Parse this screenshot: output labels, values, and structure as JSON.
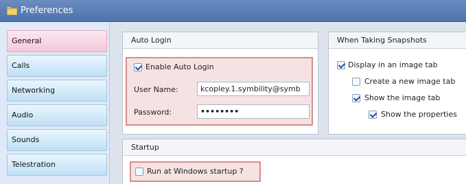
{
  "window": {
    "title": "Preferences",
    "icon": "preferences-icon"
  },
  "sidebar": {
    "items": [
      {
        "label": "General",
        "active": true
      },
      {
        "label": "Calls"
      },
      {
        "label": "Networking"
      },
      {
        "label": "Audio"
      },
      {
        "label": "Sounds"
      },
      {
        "label": "Telestration"
      }
    ]
  },
  "auto_login": {
    "title": "Auto Login",
    "enable_label": "Enable Auto Login",
    "enable_checked": true,
    "username_label": "User Name:",
    "username_value": "kcopley.1.symbility@symb",
    "password_label": "Password:",
    "password_value": "••••••••"
  },
  "snapshots": {
    "title": "When Taking Snapshots",
    "display_label": "Display in an image tab",
    "display_checked": true,
    "new_tab_label": "Create a new image tab",
    "new_tab_checked": false,
    "show_tab_label": "Show the image tab",
    "show_tab_checked": true,
    "show_props_label": "Show the properties",
    "show_props_checked": true
  },
  "startup": {
    "title": "Startup",
    "run_label": "Run at Windows startup ?",
    "run_checked": false
  },
  "colors": {
    "title_bar": "#4e74ad",
    "active_nav": "#f3c8db",
    "nav": "#bfe0f5",
    "highlight_border": "#d98b8b"
  }
}
